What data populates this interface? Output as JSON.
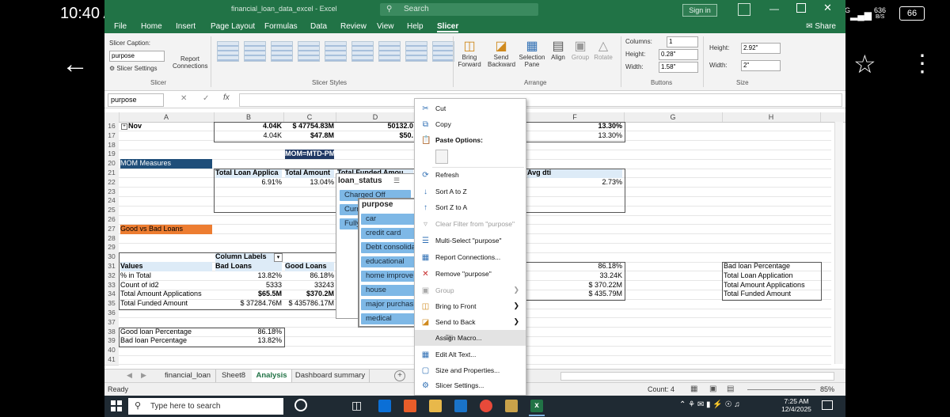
{
  "phone": {
    "time": "10:40 AM",
    "net_1": "4G",
    "net_2": "4G",
    "speed": "636",
    "speed_unit": "B/S",
    "battery": "66"
  },
  "excel": {
    "title": "financial_loan_data_excel  -  Excel",
    "search_placeholder": "Search",
    "sign_in": "Sign in",
    "share": "Share",
    "menu": [
      "File",
      "Home",
      "Insert",
      "Page Layout",
      "Formulas",
      "Data",
      "Review",
      "View",
      "Help",
      "Slicer"
    ],
    "ribbon": {
      "slicer_caption_label": "Slicer Caption:",
      "slicer_caption_value": "purpose",
      "slicer_settings": "Slicer Settings",
      "report_connections_1": "Report",
      "report_connections_2": "Connections",
      "group_slicer": "Slicer",
      "group_styles": "Slicer Styles",
      "bring_forward_1": "Bring",
      "bring_forward_2": "Forward",
      "send_backward_1": "Send",
      "send_backward_2": "Backward",
      "selection_pane_1": "Selection",
      "selection_pane_2": "Pane",
      "align": "Align",
      "group": "Group",
      "rotate": "Rotate",
      "group_arrange": "Arrange",
      "columns_label": "Columns:",
      "columns_value": "1",
      "height_label": "Height:",
      "height_value": "0.28\"",
      "width_label": "Width:",
      "width_value": "1.58\"",
      "group_buttons": "Buttons",
      "size_height_label": "Height:",
      "size_height_value": "2.92\"",
      "size_width_label": "Width:",
      "size_width_value": "2\"",
      "group_size": "Size"
    },
    "namebox": "purpose",
    "columns": [
      "A",
      "B",
      "C",
      "D",
      "E",
      "F",
      "G",
      "H"
    ],
    "rows": [
      "16",
      "17",
      "18",
      "19",
      "20",
      "21",
      "22",
      "23",
      "24",
      "25",
      "26",
      "27",
      "28",
      "29",
      "30",
      "31",
      "32",
      "33",
      "34",
      "35",
      "36",
      "37",
      "38",
      "39",
      "40",
      "41"
    ],
    "cells": {
      "a16": "Nov",
      "b16": "4.04K",
      "c16": "$ 47754.83M",
      "d16": "50132.0",
      "f16": "13.30%",
      "b17": "4.04K",
      "c17": "$47.8M",
      "d17": "$50.",
      "f17": "13.30%",
      "c19": "MOM=MTD-PM",
      "a20": "MOM Measures",
      "b21": "Total Loan Applica",
      "c21": "Total Amount",
      "d21": "Total Funded Amou",
      "f21": "Avg dti",
      "b22": "6.91%",
      "c22": "13.04%",
      "f22": "2.73%",
      "a27": "Good vs Bad Loans",
      "b30": "Column Labels",
      "a31": "Values",
      "b31": "Bad Loans",
      "c31": "Good Loans",
      "a32": "% in Total",
      "b32": "13.82%",
      "c32": "86.18%",
      "a33": "Count of id2",
      "b33": "5333",
      "c33": "33243",
      "a34": "Total Amount Applications",
      "b34": "$65.5M",
      "c34": "$370.2M",
      "a35": "Total Funded Amount",
      "b35": "$ 37284.76M",
      "c35": "$ 435786.17M",
      "f31": "86.18%",
      "f32": "33.24K",
      "f33": "$ 370.22M",
      "f34": "$ 435.79M",
      "h31": "Bad loan Percentage",
      "h32": "Total Loan Application",
      "h33": "Total Amount Applications",
      "h34": "Total Funded Amount",
      "a38": "Good loan Percentage",
      "b38": "86.18%",
      "a39": "Bad loan Percentage",
      "b39": "13.82%"
    },
    "slicer_status": {
      "title": "loan_status",
      "items": [
        "Charged Off",
        "Curr",
        "Fully"
      ]
    },
    "slicer_purpose": {
      "title": "purpose",
      "items": [
        "car",
        "credit card",
        "Debt consolida",
        "educational",
        "home improve",
        "house",
        "major purchas",
        "medical"
      ]
    },
    "context_menu": {
      "cut": "Cut",
      "copy": "Copy",
      "paste_options": "Paste Options:",
      "refresh": "Refresh",
      "sort_az": "Sort A to Z",
      "sort_za": "Sort Z to A",
      "clear_filter": "Clear Filter from \"purpose\"",
      "multi_select": "Multi-Select \"purpose\"",
      "report_connections": "Report Connections...",
      "remove": "Remove \"purpose\"",
      "group": "Group",
      "bring_front": "Bring to Front",
      "send_back": "Send to Back",
      "assign_macro": "Assign Macro...",
      "edit_alt": "Edit Alt Text...",
      "size_props": "Size and Properties...",
      "slicer_settings": "Slicer Settings..."
    },
    "sheet_tabs": [
      "financial_loan",
      "Sheet8",
      "Analysis",
      "Dashboard summary"
    ],
    "status": {
      "ready": "Ready",
      "count": "Count: 4",
      "zoom": "85%"
    }
  },
  "taskbar": {
    "search_placeholder": "Type here to search",
    "time": "7:25 AM",
    "date": "12/4/2025"
  }
}
